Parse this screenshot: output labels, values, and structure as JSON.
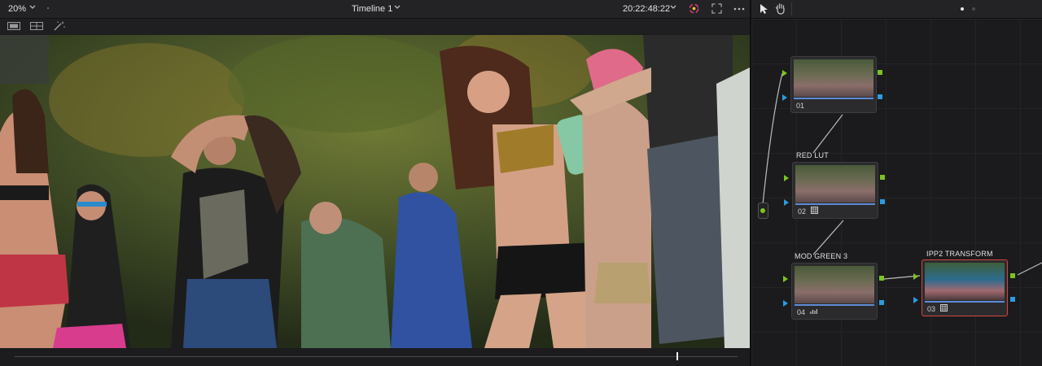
{
  "viewer": {
    "zoom": "20%",
    "timeline_name": "Timeline 1",
    "timecode": "20:22:48:22",
    "playhead_fraction": 0.915
  },
  "colors": {
    "node_selected_border": "#d4463a",
    "output_port": "#7bc41f",
    "key_port": "#2d9be0",
    "bar": "#5f8cd6"
  },
  "icons": {
    "zoom_dropdown": "chevron-down-icon",
    "timeline_dropdown": "chevron-down-icon",
    "timecode_dropdown": "chevron-down-icon",
    "color_scope": "color-wheel-icon",
    "fullscreen": "fullscreen-icon",
    "more": "more-icon",
    "pointer": "pointer-icon",
    "hand": "hand-icon",
    "single_view": "single-viewer-icon",
    "split_view": "split-view-icon",
    "magic_mask": "magic-wand-icon"
  },
  "nodes": [
    {
      "number": "01",
      "label": ""
    },
    {
      "number": "02",
      "label": "RED LUT"
    },
    {
      "number": "04",
      "label": "MOD GREEN 3"
    },
    {
      "number": "03",
      "label": "IPP2 TRANSFORM"
    }
  ]
}
